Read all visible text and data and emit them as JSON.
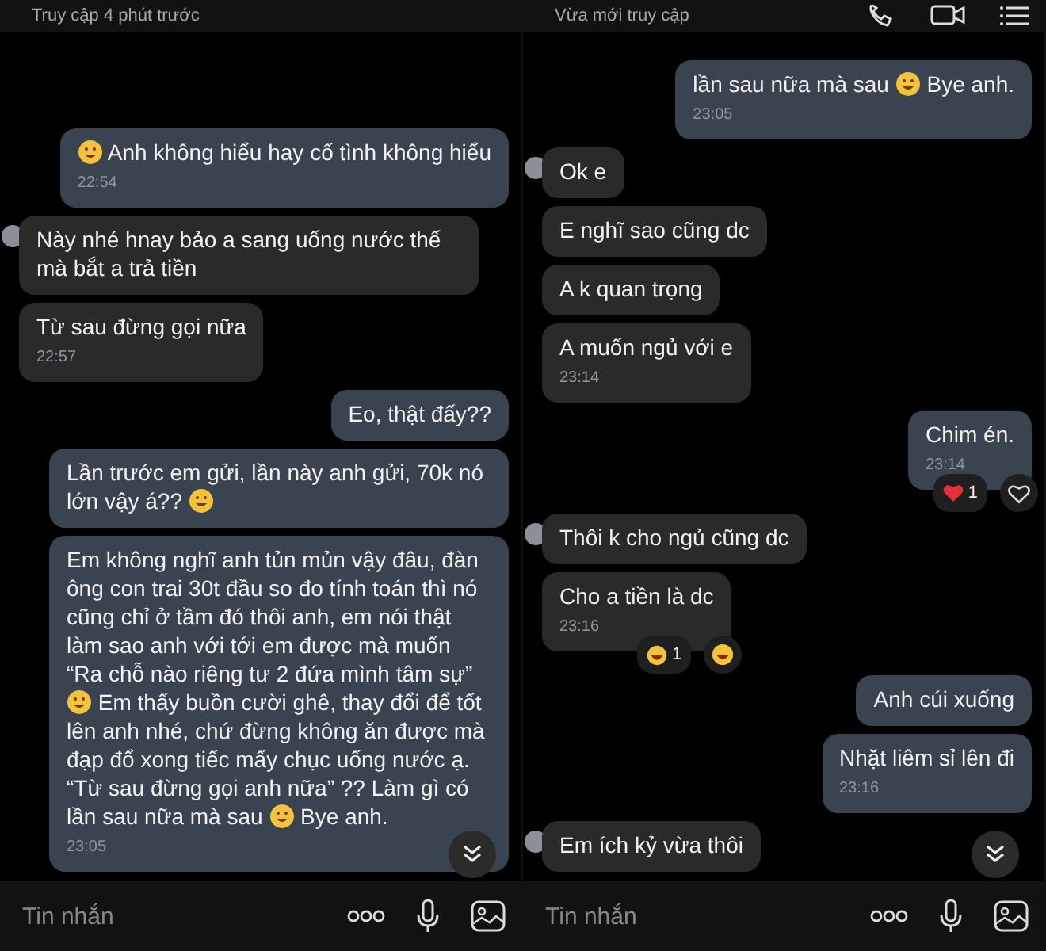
{
  "panels": [
    {
      "header": {
        "status": "Truy cập 4 phút trước",
        "call_icons": false
      },
      "messages": [
        {
          "kind": "out",
          "avatar": false,
          "parts": [
            {
              "kind": "emoji"
            },
            {
              "kind": "text",
              "text": " Anh không hiểu hay cố tình không hiểu"
            }
          ],
          "time": "22:54"
        },
        {
          "kind": "in",
          "avatar": true,
          "parts": [
            {
              "kind": "text",
              "text": "Này nhé hnay bảo a sang uống nước thế mà bắt a trả tiền"
            }
          ]
        },
        {
          "kind": "in",
          "avatar": false,
          "parts": [
            {
              "kind": "text",
              "text": "Từ sau đừng gọi nữa"
            }
          ],
          "time": "22:57"
        },
        {
          "kind": "out",
          "avatar": false,
          "parts": [
            {
              "kind": "text",
              "text": "Eo, thật đấy??"
            }
          ]
        },
        {
          "kind": "out",
          "avatar": false,
          "parts": [
            {
              "kind": "text",
              "text": "Lần trước em gửi, lần này anh gửi, 70k nó lớn vậy á?? "
            },
            {
              "kind": "emoji"
            }
          ]
        },
        {
          "kind": "out",
          "avatar": false,
          "parts": [
            {
              "kind": "text",
              "text": "Em không nghĩ anh tủn mủn vậy đâu, đàn ông con trai 30t đầu so đo tính toán thì nó cũng chỉ ở tầm đó thôi anh, em nói thật làm sao anh với tới em được mà muốn “Ra chỗ nào riêng tư 2 đứa mình tâm sự” "
            },
            {
              "kind": "emoji"
            },
            {
              "kind": "text",
              "text": " Em thấy buồn cười ghê, thay đổi để tốt lên anh nhé, chứ đừng không ăn được mà đạp đổ xong tiếc mấy chục uống nước ạ. “Từ sau đừng gọi anh nữa” ?? Làm gì có lần sau nữa mà sau "
            },
            {
              "kind": "emoji"
            },
            {
              "kind": "text",
              "text": " Bye anh."
            }
          ],
          "time": "23:05"
        }
      ],
      "composer": {
        "placeholder": "Tin nhắn"
      }
    },
    {
      "header": {
        "status": "Vừa mới truy cập",
        "call_icons": true
      },
      "messages": [
        {
          "kind": "out",
          "avatar": false,
          "parts": [
            {
              "kind": "text",
              "text": "lần sau nữa mà sau "
            },
            {
              "kind": "emoji"
            },
            {
              "kind": "text",
              "text": " Bye anh."
            }
          ],
          "time": "23:05"
        },
        {
          "kind": "in",
          "avatar": true,
          "parts": [
            {
              "kind": "text",
              "text": "Ok e"
            }
          ]
        },
        {
          "kind": "in",
          "avatar": false,
          "parts": [
            {
              "kind": "text",
              "text": "E nghĩ sao cũng dc"
            }
          ]
        },
        {
          "kind": "in",
          "avatar": false,
          "parts": [
            {
              "kind": "text",
              "text": "A k quan trọng"
            }
          ]
        },
        {
          "kind": "in",
          "avatar": false,
          "parts": [
            {
              "kind": "text",
              "text": "A muốn ngủ với e"
            }
          ],
          "time": "23:14"
        },
        {
          "kind": "out",
          "avatar": false,
          "parts": [
            {
              "kind": "text",
              "text": "Chim én."
            }
          ],
          "time": "23:14",
          "reaction": {
            "kind": "heart",
            "count": "1"
          }
        },
        {
          "kind": "in",
          "avatar": true,
          "parts": [
            {
              "kind": "text",
              "text": "Thôi k cho ngủ cũng dc"
            }
          ]
        },
        {
          "kind": "in",
          "avatar": false,
          "parts": [
            {
              "kind": "text",
              "text": "Cho a tiền là dc"
            }
          ],
          "time": "23:16",
          "reaction": {
            "kind": "laugh",
            "count": "1"
          }
        },
        {
          "kind": "out",
          "avatar": false,
          "parts": [
            {
              "kind": "text",
              "text": "Anh cúi xuống"
            }
          ]
        },
        {
          "kind": "out",
          "avatar": false,
          "parts": [
            {
              "kind": "text",
              "text": "Nhặt liêm sỉ lên đi"
            }
          ],
          "time": "23:16"
        },
        {
          "kind": "in",
          "avatar": true,
          "parts": [
            {
              "kind": "text",
              "text": "Em ích kỷ vừa thôi"
            }
          ]
        }
      ],
      "composer": {
        "placeholder": "Tin nhắn"
      }
    }
  ]
}
